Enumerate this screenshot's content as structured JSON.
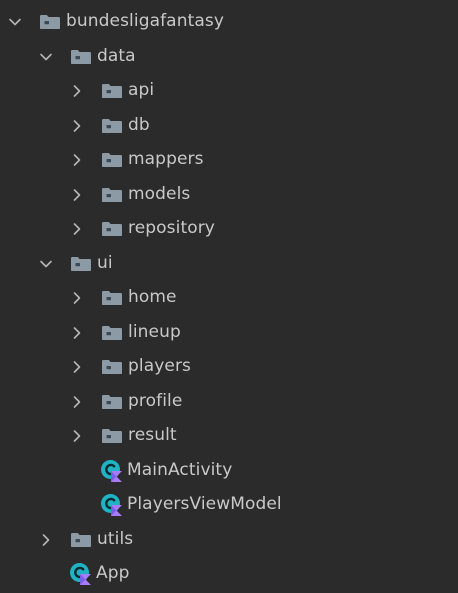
{
  "tree": [
    {
      "id": "bundesligafantasy",
      "label": "bundesligafantasy",
      "type": "folder",
      "depth": 0,
      "expanded": true
    },
    {
      "id": "data",
      "label": "data",
      "type": "folder",
      "depth": 1,
      "expanded": true
    },
    {
      "id": "api",
      "label": "api",
      "type": "folder",
      "depth": 2,
      "expanded": false
    },
    {
      "id": "db",
      "label": "db",
      "type": "folder",
      "depth": 2,
      "expanded": false
    },
    {
      "id": "mappers",
      "label": "mappers",
      "type": "folder",
      "depth": 2,
      "expanded": false
    },
    {
      "id": "models",
      "label": "models",
      "type": "folder",
      "depth": 2,
      "expanded": false
    },
    {
      "id": "repository",
      "label": "repository",
      "type": "folder",
      "depth": 2,
      "expanded": false
    },
    {
      "id": "ui",
      "label": "ui",
      "type": "folder",
      "depth": 1,
      "expanded": true
    },
    {
      "id": "home",
      "label": "home",
      "type": "folder",
      "depth": 2,
      "expanded": false
    },
    {
      "id": "lineup",
      "label": "lineup",
      "type": "folder",
      "depth": 2,
      "expanded": false
    },
    {
      "id": "players",
      "label": "players",
      "type": "folder",
      "depth": 2,
      "expanded": false
    },
    {
      "id": "profile",
      "label": "profile",
      "type": "folder",
      "depth": 2,
      "expanded": false
    },
    {
      "id": "result",
      "label": "result",
      "type": "folder",
      "depth": 2,
      "expanded": false
    },
    {
      "id": "mainactivity",
      "label": "MainActivity",
      "type": "kotlin-class",
      "depth": 2
    },
    {
      "id": "playersviewmodel",
      "label": "PlayersViewModel",
      "type": "kotlin-class",
      "depth": 2
    },
    {
      "id": "utils",
      "label": "utils",
      "type": "folder",
      "depth": 1,
      "expanded": false
    },
    {
      "id": "app",
      "label": "App",
      "type": "kotlin-class",
      "depth": 1
    }
  ],
  "colors": {
    "background": "#2b2b2b",
    "text": "#c9c9c9",
    "chevron": "#b5b5b5",
    "folder": "#8c9aa6",
    "folder_dark": "#3c4a55",
    "class_teal": "#1fb3c4",
    "kotlin_purple": "#a97bff"
  }
}
